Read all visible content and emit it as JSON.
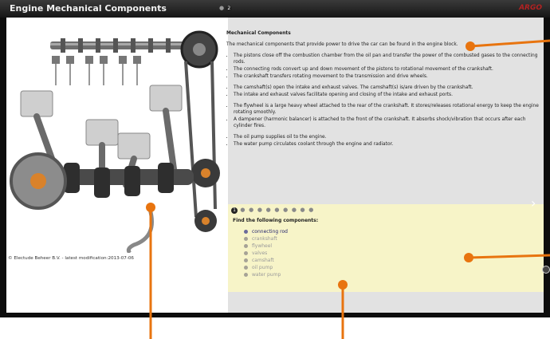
{
  "window": {
    "title": "Engine Mechanical Components",
    "logo": "ARGO"
  },
  "copyright": "© Electude Beheer B.V. - latest modification:2013-07-06",
  "page_dots": {
    "active": "2"
  },
  "info": {
    "heading": "Mechanical Components",
    "intro": "The mechanical components that provide power to drive the car can be found in the engine block.",
    "group1": [
      "The pistons close off the combustion chamber from the oil pan and transfer the power of the combusted gases to the connecting rods.",
      "The connecting rods convert up and down movement of the pistons to rotational movement of the crankshaft.",
      "The crankshaft transfers rotating movement to the transmission and drive wheels."
    ],
    "group2": [
      "The camshaft(s) open the intake and exhaust valves. The camshaft(s) is/are driven by the crankshaft.",
      "The intake and exhaust valves facilitate opening and closing of the intake and exhaust ports."
    ],
    "group3": [
      "The flywheel is a large heavy wheel attached to the rear of the crankshaft. It stores/releases rotational energy to keep the engine rotating smoothly.",
      "A dampener (harmonic balancer) is attached to the front of the crankshaft. It absorbs shock/vibration that occurs after each cylinder fires."
    ],
    "group4": [
      "The oil pump supplies oil to the engine.",
      "The water pump circulates coolant through the engine and radiator."
    ]
  },
  "quiz": {
    "active_dot": "1",
    "instruction": "Find the following components:",
    "items": [
      "connecting rod",
      "crankshaft",
      "flywheel",
      "valves",
      "camshaft",
      "oil pump",
      "water pump"
    ]
  },
  "colors": {
    "annotation": "#e8740f",
    "quiz_bg": "#f7f4c8",
    "panel_bg": "#e2e2e2",
    "active_item": "#1f1f6b"
  }
}
